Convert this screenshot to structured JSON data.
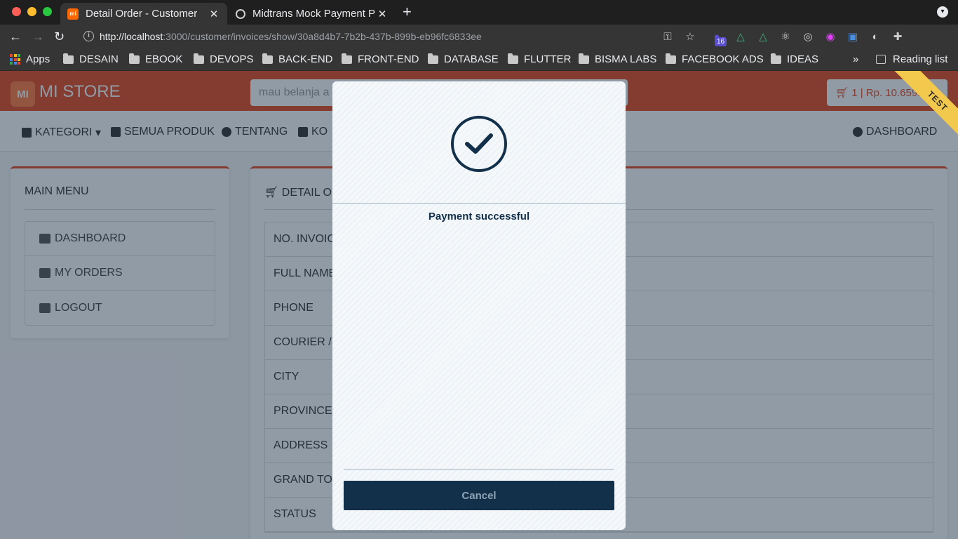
{
  "browser": {
    "tabs": [
      {
        "title": "Detail Order - Customer",
        "close": "✕"
      },
      {
        "title": "Midtrans Mock Payment P",
        "close": "✕"
      }
    ],
    "new_tab": "+",
    "url_host": "http://localhost",
    "url_path": ":3000/customer/invoices/show/30a8d4b7-7b2b-437b-899b-eb96fc6833ee",
    "ext_badge": "16",
    "bookmarks": [
      "Apps",
      "DESAIN",
      "EBOOK",
      "DEVOPS",
      "BACK-END",
      "FRONT-END",
      "DATABASE",
      "FLUTTER",
      "BISMA LABS",
      "FACEBOOK ADS",
      "IDEAS"
    ],
    "more_bookmarks": "»",
    "reading_list": "Reading list"
  },
  "site": {
    "logo": "MI",
    "brand": "MI STORE",
    "search_placeholder": "mau belanja a",
    "cart": "1 | Rp. 10.659.020",
    "nav": {
      "kategori": "KATEGORI",
      "semua_produk": "SEMUA PRODUK",
      "tentang": "TENTANG",
      "kontak": "KO",
      "dashboard": "DASHBOARD"
    },
    "ribbon": "TEST"
  },
  "sidebar": {
    "title": "MAIN MENU",
    "items": [
      {
        "label": "DASHBOARD"
      },
      {
        "label": "MY ORDERS"
      },
      {
        "label": "LOGOUT"
      }
    ]
  },
  "detail": {
    "title": "DETAIL O",
    "rows": [
      {
        "label": "NO. INVOICE"
      },
      {
        "label": "FULL NAME"
      },
      {
        "label": "PHONE"
      },
      {
        "label": "COURIER /"
      },
      {
        "label": "CITY"
      },
      {
        "label": "PROVINCE"
      },
      {
        "label": "ADDRESS"
      },
      {
        "label": "GRAND TOT"
      },
      {
        "label": "STATUS"
      }
    ]
  },
  "modal": {
    "status_icon": "checkmark-icon",
    "message": "Payment successful",
    "cancel_label": "Cancel"
  },
  "colors": {
    "brand_orange": "#e8491d",
    "modal_navy": "#13304a",
    "ribbon_yellow": "#f2c94c"
  }
}
